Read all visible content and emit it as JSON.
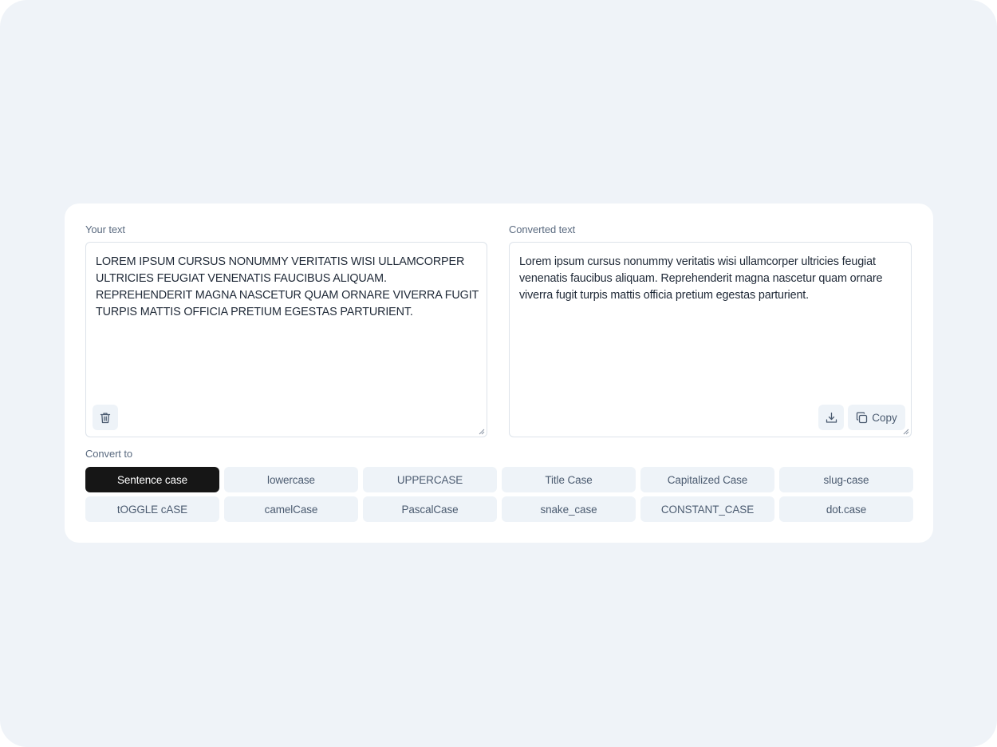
{
  "input": {
    "label": "Your text",
    "value": "LOREM IPSUM CURSUS NONUMMY VERITATIS WISI ULLAMCORPER ULTRICIES FEUGIAT VENENATIS FAUCIBUS ALIQUAM. REPREHENDERIT MAGNA NASCETUR QUAM ORNARE VIVERRA FUGIT TURPIS MATTIS OFFICIA PRETIUM EGESTAS PARTURIENT.",
    "clear_icon": "trash-icon"
  },
  "output": {
    "label": "Converted text",
    "value": "Lorem ipsum cursus nonummy veritatis wisi ullamcorper ultricies feugiat venenatis faucibus aliquam. Reprehenderit magna nascetur quam ornare viverra fugit turpis mattis officia pretium egestas parturient.",
    "download_icon": "download-icon",
    "copy_icon": "copy-icon",
    "copy_label": "Copy"
  },
  "convert": {
    "label": "Convert to",
    "options": [
      "Sentence case",
      "lowercase",
      "UPPERCASE",
      "Title Case",
      "Capitalized Case",
      "slug-case",
      "tOGGLE cASE",
      "camelCase",
      "PascalCase",
      "snake_case",
      "CONSTANT_CASE",
      "dot.case"
    ],
    "selected": "Sentence case"
  },
  "colors": {
    "page_bg": "#eff3f8",
    "card_bg": "#ffffff",
    "button_bg": "#eef3f8",
    "active_bg": "#161616",
    "label": "#5b6b80"
  }
}
